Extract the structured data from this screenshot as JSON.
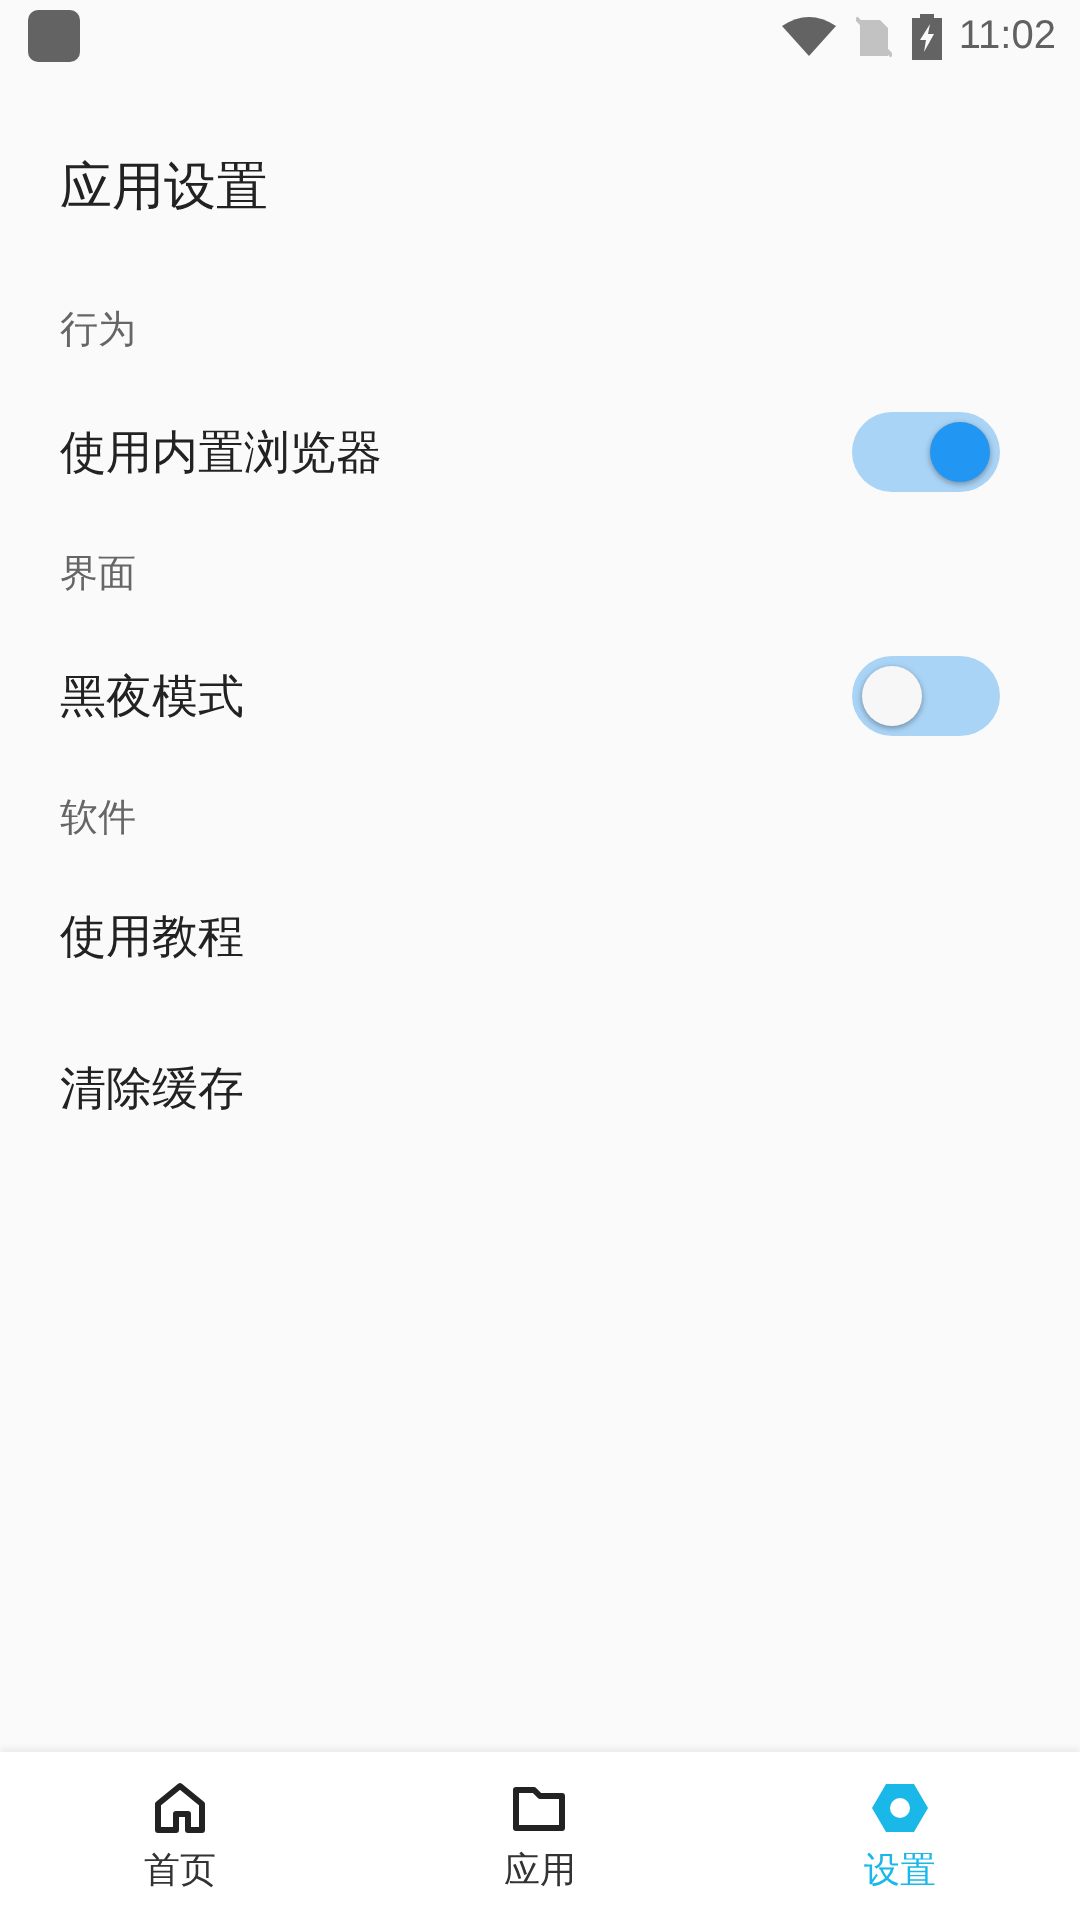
{
  "status_bar": {
    "time": "11:02"
  },
  "title": "应用设置",
  "sections": [
    {
      "header": "行为",
      "items": [
        {
          "kind": "switch",
          "label": "使用内置浏览器",
          "on": true
        }
      ]
    },
    {
      "header": "界面",
      "items": [
        {
          "kind": "switch",
          "label": "黑夜模式",
          "on": false
        }
      ]
    },
    {
      "header": "软件",
      "items": [
        {
          "kind": "link",
          "label": "使用教程"
        },
        {
          "kind": "link",
          "label": "清除缓存"
        }
      ]
    }
  ],
  "tabs": [
    {
      "label": "首页",
      "selected": false
    },
    {
      "label": "应用",
      "selected": false
    },
    {
      "label": "设置",
      "selected": true
    }
  ]
}
